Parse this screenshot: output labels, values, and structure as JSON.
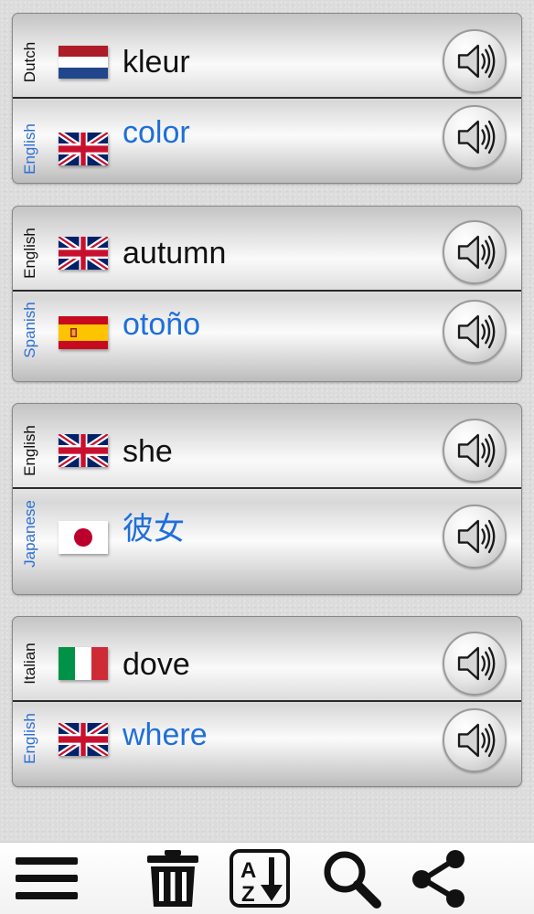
{
  "cards": [
    {
      "primary": {
        "language": "Dutch",
        "flag": "flag-nl",
        "word": "kleur"
      },
      "secondary": {
        "language": "English",
        "flag": "flag-uk",
        "word": "color"
      }
    },
    {
      "primary": {
        "language": "English",
        "flag": "flag-uk",
        "word": "autumn"
      },
      "secondary": {
        "language": "Spanish",
        "flag": "flag-es",
        "word": "otoño"
      }
    },
    {
      "primary": {
        "language": "English",
        "flag": "flag-uk",
        "word": "she"
      },
      "secondary": {
        "language": "Japanese",
        "flag": "flag-jp",
        "word": "彼女"
      }
    },
    {
      "primary": {
        "language": "Italian",
        "flag": "flag-it",
        "word": "dove"
      },
      "secondary": {
        "language": "English",
        "flag": "flag-uk",
        "word": "where"
      }
    }
  ],
  "toolbar": {
    "items": [
      "menu-icon",
      "trash-icon",
      "sort-az-icon",
      "search-icon",
      "share-icon"
    ]
  },
  "colors": {
    "primary_text": "#111111",
    "secondary_text": "#1e6fdc",
    "language_secondary": "#2d6fd6"
  }
}
